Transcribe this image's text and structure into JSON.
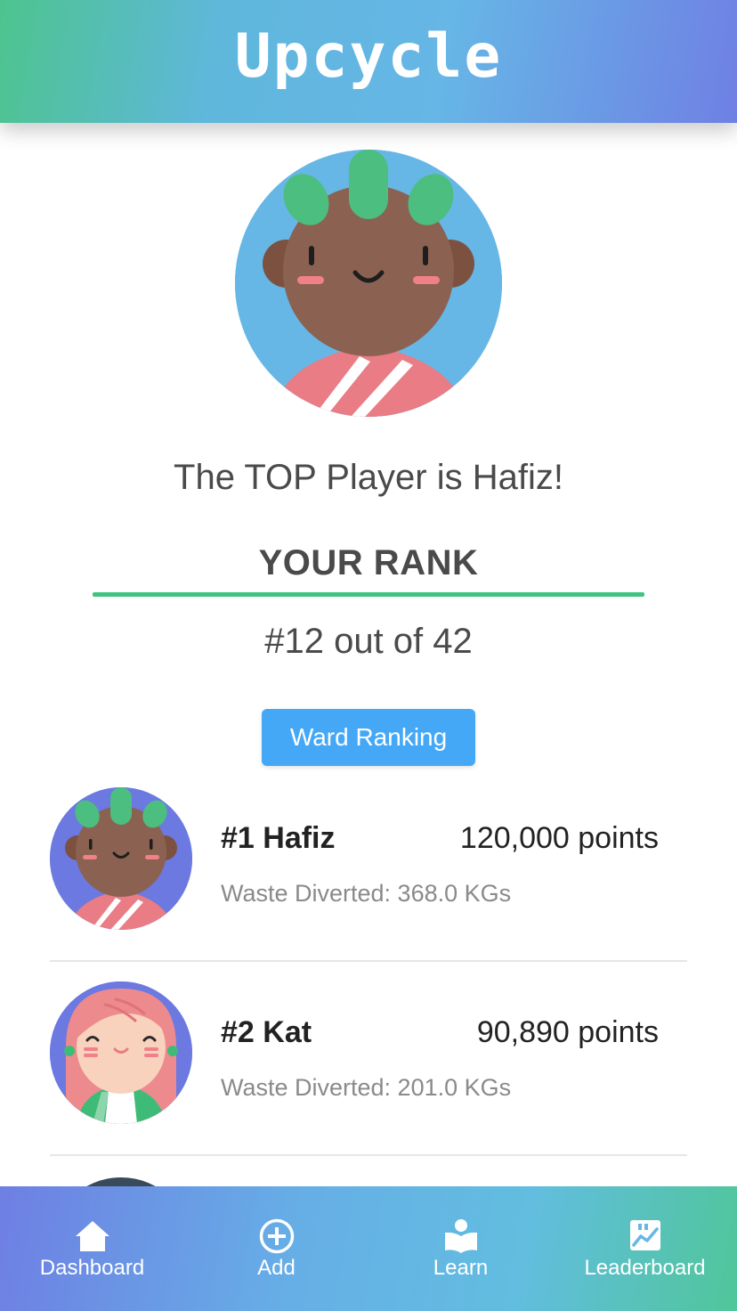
{
  "app": {
    "title": "Upcycle"
  },
  "hero": {
    "avatar_icon": "hafiz-avatar-icon",
    "top_player_text": "The TOP Player is Hafiz!",
    "rank_heading": "YOUR RANK",
    "rank_value": "#12 out of 42"
  },
  "ward_button": {
    "label": "Ward Ranking"
  },
  "leaderboard": {
    "entries": [
      {
        "name": "#1 Hafiz",
        "points": "120,000 points",
        "waste": "Waste Diverted: 368.0 KGs",
        "avatar_icon": "hafiz-avatar-icon"
      },
      {
        "name": "#2 Kat",
        "points": "90,890 points",
        "waste": "Waste Diverted: 201.0 KGs",
        "avatar_icon": "kat-avatar-icon"
      }
    ]
  },
  "nav": {
    "items": [
      {
        "label": "Dashboard",
        "icon": "home-icon"
      },
      {
        "label": "Add",
        "icon": "plus-circle-icon"
      },
      {
        "label": "Learn",
        "icon": "book-reader-icon"
      },
      {
        "label": "Leaderboard",
        "icon": "chart-icon"
      }
    ]
  },
  "colors": {
    "accent_green": "#3fc47f",
    "button_blue": "#45a8f7",
    "header_gradient_start": "#4dc48e",
    "header_gradient_end": "#6f80e4"
  }
}
